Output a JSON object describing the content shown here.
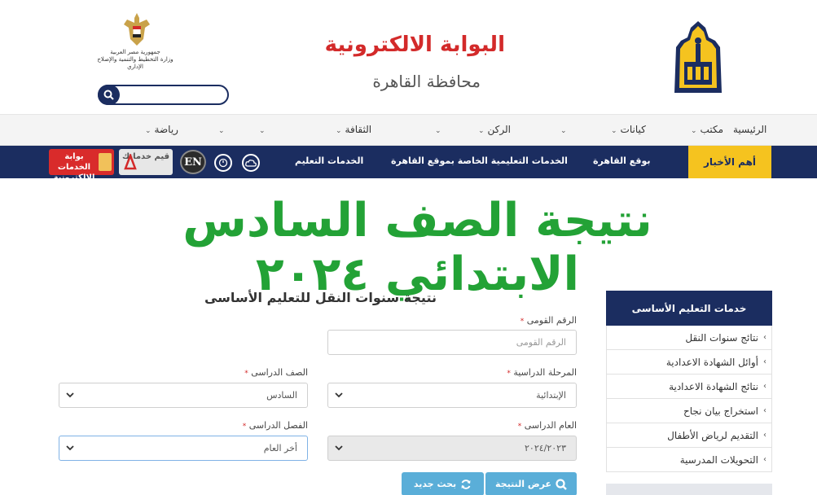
{
  "header": {
    "title": "البوابة الالكترونية",
    "subtitle": "محافظة القاهرة",
    "ministry_text": "جمهورية مصر العربية\nوزارة التخطيط والتنمية والإصلاح الإداري",
    "search_placeholder": ""
  },
  "topnav": {
    "items": [
      {
        "label": "الرئيسية",
        "has_dropdown": false
      },
      {
        "label": "مكتب",
        "has_dropdown": true
      },
      {
        "label": "كيانات",
        "has_dropdown": true
      },
      {
        "label": "",
        "has_dropdown": true
      },
      {
        "label": "الركن",
        "has_dropdown": true
      },
      {
        "label": "",
        "has_dropdown": true
      },
      {
        "label": "الثقافة",
        "has_dropdown": true
      },
      {
        "label": "",
        "has_dropdown": true
      },
      {
        "label": "",
        "has_dropdown": true
      },
      {
        "label": "رياضة",
        "has_dropdown": true
      }
    ]
  },
  "bluebar": {
    "news_label": "أهم الأخبار",
    "links": [
      "بوقع القاهرة",
      "الخدمات التعليمية الخاصة بموقع القاهرة",
      "الخدمات التعليم"
    ],
    "en_label": "EN",
    "qayem_label": "قيم خدماتك",
    "portal_label": "بوابة الخدمات الإلكترونية"
  },
  "main_heading": "نتيجة الصف السادس الابتدائي ٢٠٢٤",
  "sidebar": {
    "title": "خدمات التعليم الأساسى",
    "items": [
      "نتائج سنوات النقل",
      "أوائل الشهادة الاعدادية",
      "نتائج الشهادة الاعدادية",
      "استخراج بيان نجاح",
      "التقديم لرياض الأطفال",
      "التحويلات المدرسية"
    ]
  },
  "form": {
    "title": "نتيجة سنوات النقل للتعليم الأساسى",
    "required_mark": "*",
    "national_id": {
      "label": "الرقم القومى",
      "placeholder": "الرقم القومى",
      "value": ""
    },
    "stage": {
      "label": "المرحلة الدراسية",
      "value": "الإبتدائية"
    },
    "grade": {
      "label": "الصف الدراسى",
      "value": "السادس"
    },
    "year": {
      "label": "العام الدراسى",
      "value": "٢٠٢٤/٢٠٢٣"
    },
    "term": {
      "label": "الفصل الدراسى",
      "value": "أخر العام"
    },
    "show_result_label": "عرض النتيجة",
    "new_search_label": "بحث جديد"
  },
  "colors": {
    "navy": "#1b2d60",
    "yellow": "#f5c31f",
    "title_red": "#d32a2a",
    "heading_green": "#23a236",
    "button_blue": "#5aaed8"
  }
}
